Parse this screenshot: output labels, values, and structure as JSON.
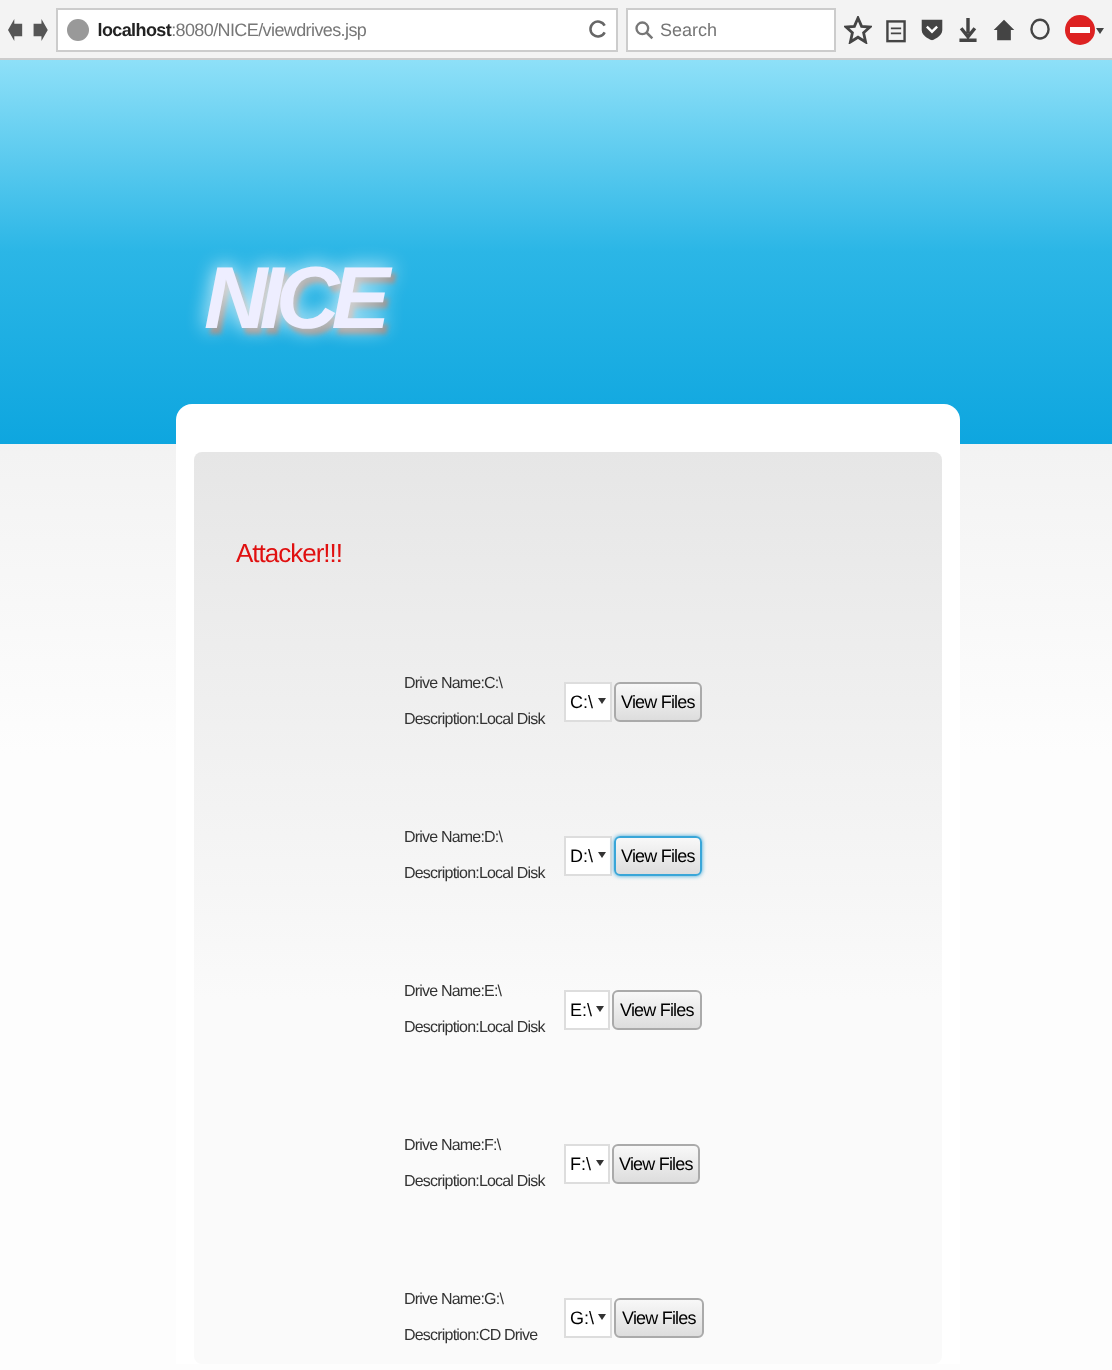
{
  "browser": {
    "url": "**localhost**:8080/NICE/viewdrives.jsp",
    "search": {
      "placeholder": "Search"
    }
  },
  "header": {
    "logo": "NICE"
  },
  "message": "Attacker!!!",
  "drives": [
    {
      "name": "Drive Name:C:\\",
      "description": "Description:Local Disk",
      "select": "C:\\",
      "button": "View Files",
      "focused": false
    },
    {
      "name": "Drive Name:D:\\",
      "description": "Description:Local Disk",
      "select": "D:\\",
      "button": "View Files",
      "focused": true
    },
    {
      "name": "Drive Name:E:\\",
      "description": "Description:Local Disk",
      "select": "E:\\",
      "button": "View Files",
      "focused": false
    },
    {
      "name": "Drive Name:F:\\",
      "description": "Description:Local Disk",
      "select": "F:\\",
      "button": "View Files",
      "focused": false
    },
    {
      "name": "Drive Name:G:\\",
      "description": "Description:CD Drive",
      "select": "G:\\",
      "button": "View Files",
      "focused": false
    }
  ]
}
